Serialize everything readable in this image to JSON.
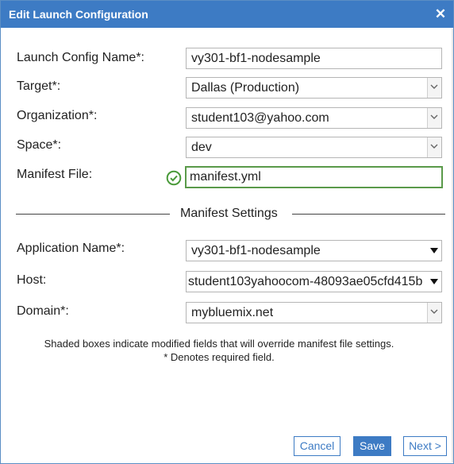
{
  "dialog": {
    "title": "Edit Launch Configuration",
    "close_icon": "close-icon"
  },
  "form": {
    "launch_config_name": {
      "label": "Launch Config Name*:",
      "value": "vy301-bf1-nodesample"
    },
    "target": {
      "label": "Target*:",
      "value": "Dallas (Production)"
    },
    "organization": {
      "label": "Organization*:",
      "value": "student103@yahoo.com"
    },
    "space": {
      "label": "Space*:",
      "value": "dev"
    },
    "manifest_file": {
      "label": "Manifest File:",
      "value": "manifest.yml",
      "status_icon": "check-circle-icon"
    }
  },
  "manifest_settings": {
    "title": "Manifest Settings",
    "application_name": {
      "label": "Application Name*:",
      "value": "vy301-bf1-nodesample"
    },
    "host": {
      "label": "Host:",
      "value": "student103yahoocom-48093ae05cfd415b"
    },
    "domain": {
      "label": "Domain*:",
      "value": "mybluemix.net"
    }
  },
  "notes": {
    "shaded": "Shaded boxes indicate modified fields that will override manifest file settings.",
    "required": "* Denotes required field."
  },
  "buttons": {
    "cancel": "Cancel",
    "save": "Save",
    "next": "Next >"
  },
  "colors": {
    "titlebar": "#3d7bc4",
    "valid_border": "#5a9a4a",
    "valid_icon": "#4a9a3a"
  }
}
